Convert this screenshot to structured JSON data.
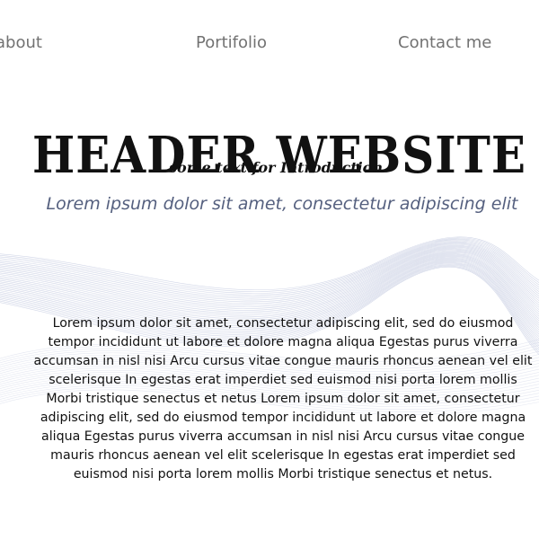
{
  "nav": {
    "items": [
      {
        "label": "about"
      },
      {
        "label": "Portifolio"
      },
      {
        "label": "Contact me"
      }
    ]
  },
  "header": {
    "title": "HEADER WEBSITE",
    "subtitle": "some text for Introduction"
  },
  "tagline": "Lorem ipsum dolor sit amet, consectetur adipiscing elit",
  "intro": {
    "paragraph": "Lorem ipsum dolor sit amet, consectetur adipiscing elit, sed do eiusmod tempor incididunt ut labore et dolore magna aliqua Egestas purus viverra accumsan in nisl nisi Arcu cursus vitae congue mauris rhoncus aenean vel elit scelerisque In egestas erat imperdiet sed euismod nisi porta lorem mollis Morbi tristique senectus et netus Lorem ipsum dolor sit amet, consectetur adipiscing elit, sed do eiusmod tempor incididunt ut labore et dolore magna aliqua Egestas purus viverra accumsan in nisl nisi Arcu cursus vitae congue mauris rhoncus aenean vel elit scelerisque In egestas erat imperdiet sed euismod nisi porta lorem mollis Morbi tristique senectus et netus."
  },
  "colors": {
    "nav_text": "#727272",
    "heading": "#111111",
    "tagline": "#55607f",
    "wave_lines": "#c9cfe3"
  }
}
